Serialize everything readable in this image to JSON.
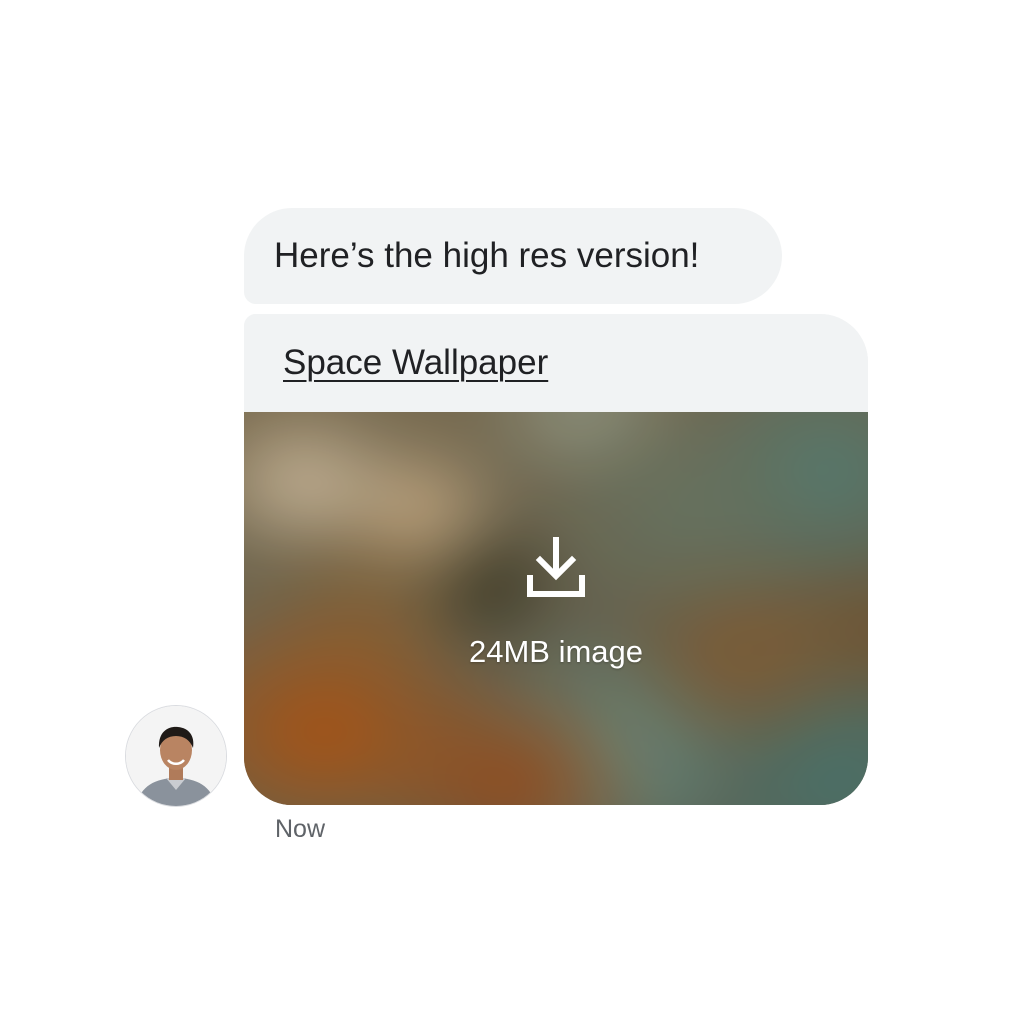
{
  "message": {
    "text": "Here’s the high res version!"
  },
  "attachment": {
    "title": "Space Wallpaper",
    "size_label": "24MB image",
    "icon": "download-icon"
  },
  "sender": {
    "avatar_icon": "avatar"
  },
  "timestamp": "Now",
  "colors": {
    "bubble_background": "#f1f3f4",
    "text_primary": "#202124",
    "text_secondary": "#5f6368",
    "overlay_text": "#ffffff"
  }
}
